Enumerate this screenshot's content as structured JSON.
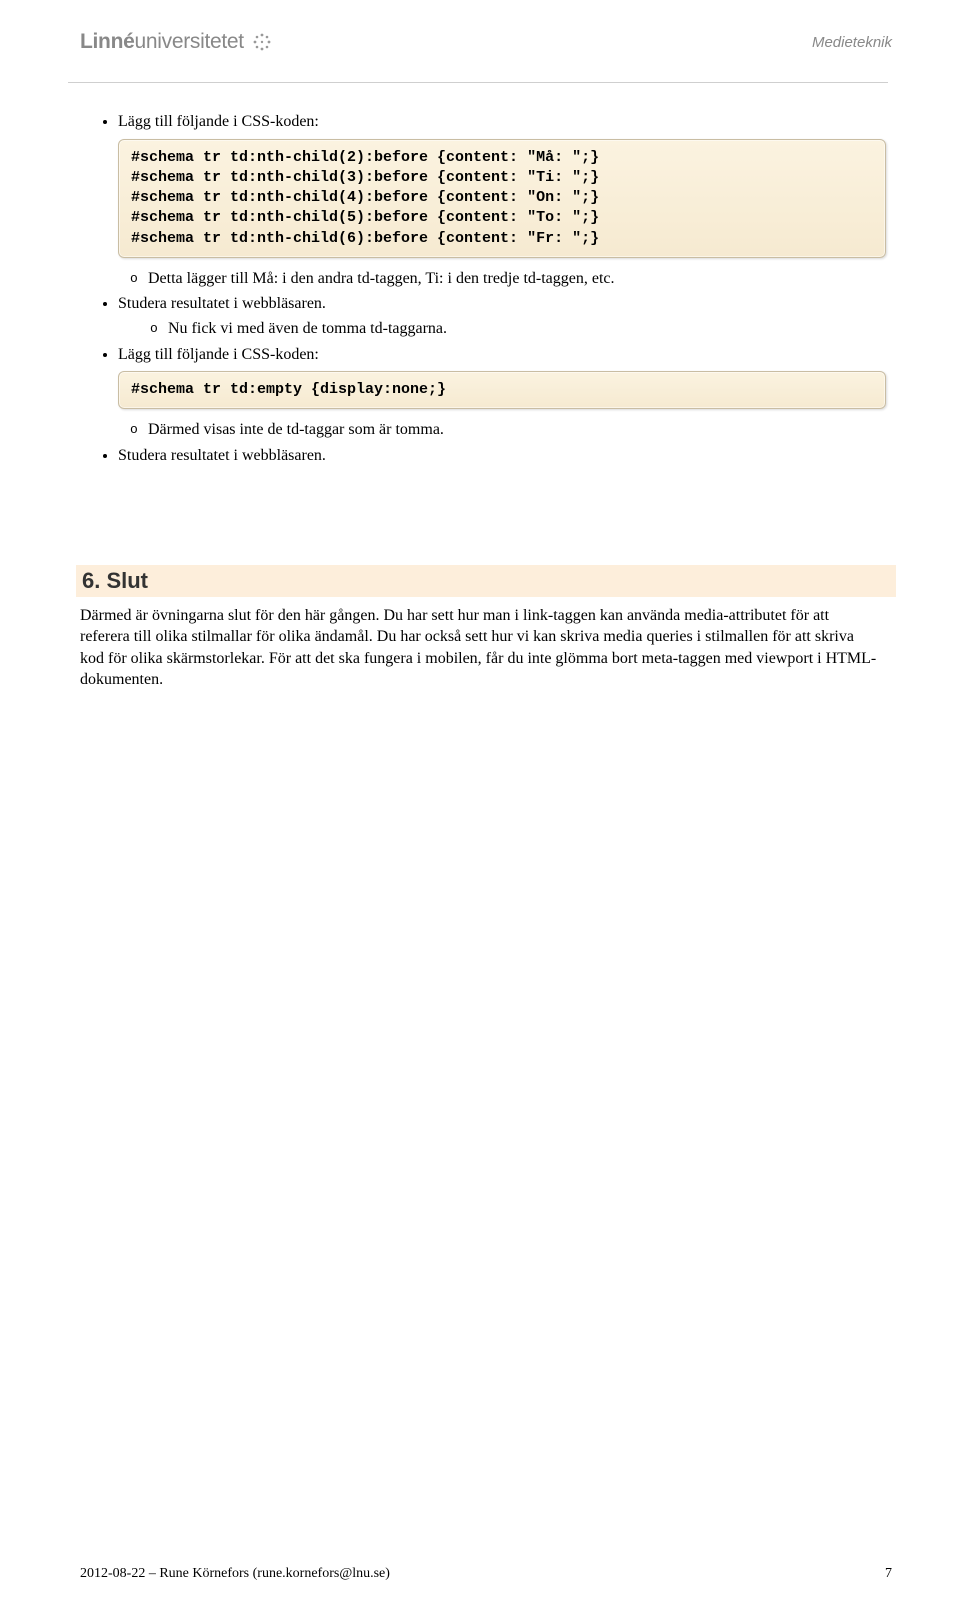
{
  "header": {
    "logo_part1": "Linné",
    "logo_part2": "universitetet",
    "right_label": "Medieteknik"
  },
  "intro_bullet": "Lägg till följande i CSS-koden:",
  "code1": "#schema tr td:nth-child(2):before {content: \"Må: \";}\n#schema tr td:nth-child(3):before {content: \"Ti: \";}\n#schema tr td:nth-child(4):before {content: \"On: \";}\n#schema tr td:nth-child(5):before {content: \"To: \";}\n#schema tr td:nth-child(6):before {content: \"Fr: \";}",
  "sub1": "Detta lägger till Må: i den andra td-taggen, Ti: i den tredje td-taggen, etc.",
  "bullet2": "Studera resultatet i webbläsaren.",
  "sub2": "Nu fick vi med även de tomma td-taggarna.",
  "bullet3": "Lägg till följande i CSS-koden:",
  "code2": "#schema tr td:empty {display:none;}",
  "sub3": "Därmed visas inte de td-taggar som är tomma.",
  "bullet4": "Studera resultatet i webbläsaren.",
  "section": {
    "heading": "6. Slut",
    "body": "Därmed är övningarna slut för den här gången. Du har sett hur man i link-taggen kan använda media-attributet för att referera till olika stilmallar för olika ändamål. Du har också sett hur vi kan skriva media queries i stilmallen för att skriva kod för olika skärmstorlekar. För att det ska fungera i mobilen, får du inte glömma bort meta-taggen med viewport i HTML-dokumenten."
  },
  "footer": {
    "left": "2012-08-22 – Rune Körnefors (rune.kornefors@lnu.se)",
    "right": "7"
  }
}
